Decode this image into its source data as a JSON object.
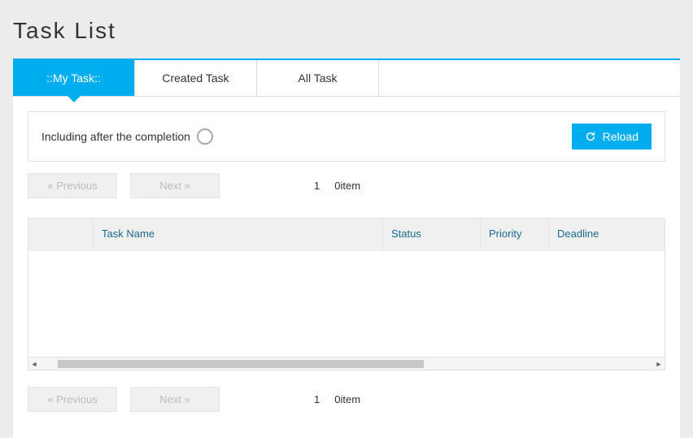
{
  "title": "Task List",
  "tabs": [
    {
      "label": "::My Task::",
      "active": true
    },
    {
      "label": "Created Task",
      "active": false
    },
    {
      "label": "All Task",
      "active": false
    }
  ],
  "filter": {
    "include_complete_label": "Including after the completion",
    "reload_label": "Reload"
  },
  "pagination": {
    "prev_label": "«   Previous",
    "next_label": "Next   »",
    "current_page": "1",
    "item_count": "0item"
  },
  "table": {
    "columns": {
      "task_name": "Task Name",
      "status": "Status",
      "priority": "Priority",
      "deadline": "Deadline"
    },
    "rows": []
  }
}
